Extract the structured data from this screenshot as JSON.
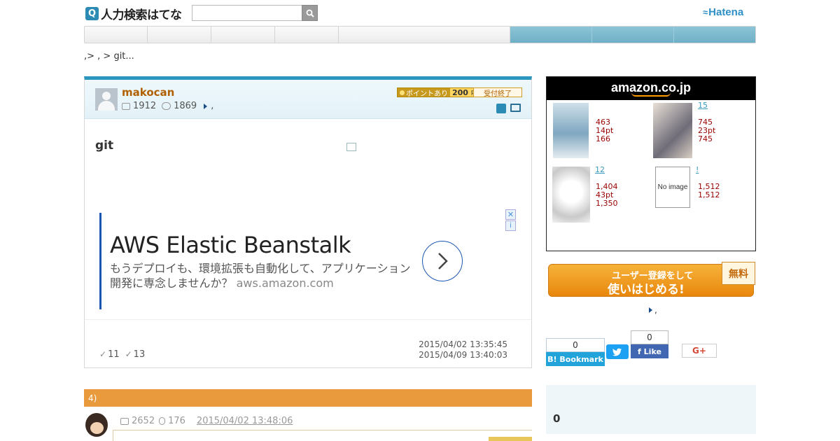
{
  "header": {
    "logo_q": "Q",
    "logo_text": "人力検索はてな",
    "search_placeholder": "",
    "brand": "Hatena",
    "brand_mark": "≈"
  },
  "nav": {
    "tabs": [
      "",
      "",
      "",
      "",
      "",
      "",
      "",
      ""
    ]
  },
  "breadcrumb": ",> , > git...",
  "question": {
    "user": "makocan",
    "stat_questions": "1912",
    "stat_answers": "1869",
    "stat_tail": ",",
    "point_label": "ポイントあり",
    "point_value": "200",
    "point_unit": "pt",
    "status": "受付終了",
    "title": "git",
    "posted": "2015/04/02 13:35:45",
    "closed": "2015/04/09 13:40:03",
    "count_a": "11",
    "count_b": "13"
  },
  "ad": {
    "headline": "AWS Elastic Beanstalk",
    "body": "もうデプロイも、環境拡張も自動化して、アプリケーション開発に専念しませんか？",
    "url": "aws.amazon.com",
    "close": "✕",
    "info": "i"
  },
  "answers": {
    "header": "4)",
    "first": {
      "stat_q": "2652",
      "stat_a": "176",
      "date": "2015/04/02 13:48:06"
    }
  },
  "amazon": {
    "logo": "amazon.co.jp",
    "products": [
      {
        "link": "",
        "l1": "463",
        "l2": "14pt",
        "l3": "166"
      },
      {
        "link": "15",
        "l1": "745",
        "l2": "23pt",
        "l3": "745"
      },
      {
        "link": "12",
        "l1": "1,404",
        "l2": "43pt",
        "l3": "1,350"
      },
      {
        "link": "!",
        "l1": "1,512",
        "l2": "",
        "l3": "1,512"
      }
    ],
    "noimage": "No image"
  },
  "signup": {
    "line1": "ユーザー登録をして",
    "line2": "使いはじめる!",
    "free": "無料"
  },
  "sidelink": ",",
  "share": {
    "bookmark_count": "0",
    "bookmark_label": "B! Bookmark",
    "tweet_label": "t",
    "like_count": "0",
    "like_label": "f Like",
    "gplus_label": "G+"
  },
  "side_panel": {
    "value": "0"
  }
}
